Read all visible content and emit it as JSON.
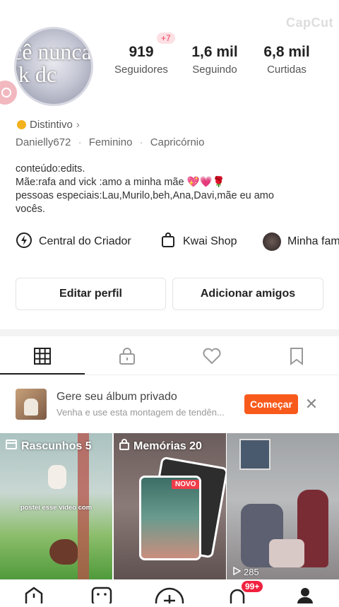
{
  "watermark": "CapCut",
  "profile": {
    "avatar_text": "cê nunca\nlk dc",
    "stats": [
      {
        "value": "919",
        "label": "Seguidores"
      },
      {
        "value": "1,6 mil",
        "label": "Seguindo"
      },
      {
        "value": "6,8 mil",
        "label": "Curtidas"
      }
    ],
    "new_followers_badge": "+7",
    "distintivo": "Distintivo",
    "username": "Danielly672",
    "gender": "Feminino",
    "sign": "Capricórnio",
    "bio": [
      "conteúdo:edits.",
      "Mãe:rafa and vick :amo a minha mãe 💖💗🌹",
      "pessoas especiais:Lau,Murilo,beh,Ana,Davi,mãe eu amo",
      "vocês."
    ]
  },
  "quick_links": [
    {
      "label": "Central do Criador",
      "icon": "lightning-circle-icon"
    },
    {
      "label": "Kwai Shop",
      "icon": "shopping-bag-icon"
    },
    {
      "label": "Minha fam",
      "icon": "family-avatar-icon"
    }
  ],
  "actions": {
    "edit": "Editar perfil",
    "add_friends": "Adicionar amigos"
  },
  "tabs": [
    {
      "name": "grid",
      "icon": "grid-icon"
    },
    {
      "name": "private",
      "icon": "lock-icon"
    },
    {
      "name": "likes",
      "icon": "heart-icon"
    },
    {
      "name": "saved",
      "icon": "bookmark-icon"
    }
  ],
  "album_banner": {
    "title": "Gere seu álbum privado",
    "subtitle": "Venha e use esta montagem de tendên...",
    "button": "Começar"
  },
  "tiles": [
    {
      "label": "Rascunhos 5",
      "caption": "postei esse vídeo com"
    },
    {
      "label": "Memórias 20",
      "badge": "NOVO"
    },
    {
      "plays": "285"
    }
  ],
  "nav_badge": "99+",
  "colors": {
    "accent": "#f85a1b",
    "badge": "#f0213f"
  }
}
